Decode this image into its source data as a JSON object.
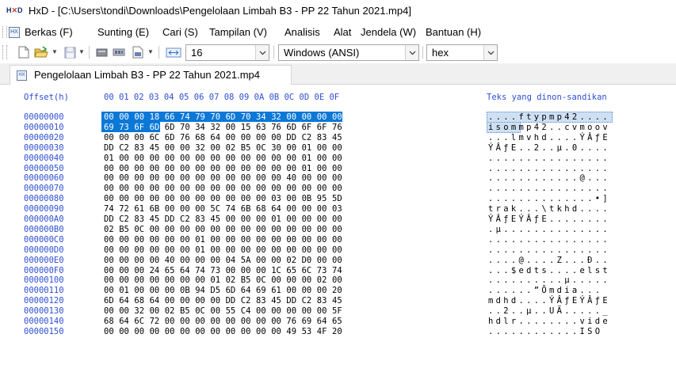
{
  "window": {
    "title": "HxD - [C:\\Users\\tondi\\Downloads\\Pengelolaan Limbah B3 - PP 22 Tahun 2021.mp4]",
    "app_icon_label": "HxD"
  },
  "menu": [
    "Berkas (F)",
    "Sunting (E)",
    "Cari (S)",
    "Tampilan (V)",
    "Analisis",
    "Alat",
    "Jendela (W)",
    "Bantuan (H)"
  ],
  "toolbar": {
    "icons": [
      "new-file-icon",
      "open-file-icon",
      "save-icon",
      "disk-icon",
      "ram-icon",
      "open-disk-image-icon",
      "bytes-per-row-icon"
    ],
    "bytes_per_row": "16",
    "charset": "Windows (ANSI)",
    "offset_base": "hex"
  },
  "tab": {
    "label": "Pengelolaan Limbah B3 - PP 22 Tahun 2021.mp4"
  },
  "editor": {
    "offset_header": "Offset(h)",
    "column_headers": [
      "00",
      "01",
      "02",
      "03",
      "04",
      "05",
      "06",
      "07",
      "08",
      "09",
      "0A",
      "0B",
      "0C",
      "0D",
      "0E",
      "0F"
    ],
    "text_header": "Teks yang dinon-sandikan",
    "selection": {
      "start_offset": "00000000",
      "length_bytes": 20
    },
    "rows": [
      {
        "offset": "00000000",
        "hex": "00 00 00 18 66 74 79 70 6D 70 34 32 00 00 00 00",
        "text": "....ftypmp42...."
      },
      {
        "offset": "00000010",
        "hex": "69 73 6F 6D 6D 70 34 32 00 15 63 76 6D 6F 6F 76",
        "text": "isommp42..cvmoov"
      },
      {
        "offset": "00000020",
        "hex": "00 00 00 6C 6D 76 68 64 00 00 00 00 DD C2 83 45",
        "text": "...lmvhd....ÝÂƒE"
      },
      {
        "offset": "00000030",
        "hex": "DD C2 83 45 00 00 32 00 02 B5 0C 30 00 01 00 00",
        "text": "ÝÂƒE..2..µ.0...."
      },
      {
        "offset": "00000040",
        "hex": "01 00 00 00 00 00 00 00 00 00 00 00 00 01 00 00",
        "text": "................"
      },
      {
        "offset": "00000050",
        "hex": "00 00 00 00 00 00 00 00 00 00 00 00 00 01 00 00",
        "text": "................"
      },
      {
        "offset": "00000060",
        "hex": "00 00 00 00 00 00 00 00 00 00 00 00 40 00 00 00",
        "text": "............@..."
      },
      {
        "offset": "00000070",
        "hex": "00 00 00 00 00 00 00 00 00 00 00 00 00 00 00 00",
        "text": "................"
      },
      {
        "offset": "00000080",
        "hex": "00 00 00 00 00 00 00 00 00 00 00 03 00 0B 95 5D",
        "text": "..............•]"
      },
      {
        "offset": "00000090",
        "hex": "74 72 61 6B 00 00 00 5C 74 6B 68 64 00 00 00 03",
        "text": "trak...\\tkhd...."
      },
      {
        "offset": "000000A0",
        "hex": "DD C2 83 45 DD C2 83 45 00 00 00 01 00 00 00 00",
        "text": "ÝÂƒEÝÂƒE........"
      },
      {
        "offset": "000000B0",
        "hex": "02 B5 0C 00 00 00 00 00 00 00 00 00 00 00 00 00",
        "text": ".µ.............."
      },
      {
        "offset": "000000C0",
        "hex": "00 00 00 00 00 00 01 00 00 00 00 00 00 00 00 00",
        "text": "................"
      },
      {
        "offset": "000000D0",
        "hex": "00 00 00 00 00 00 01 00 00 00 00 00 00 00 00 00",
        "text": "................"
      },
      {
        "offset": "000000E0",
        "hex": "00 00 00 00 40 00 00 00 04 5A 00 00 02 D0 00 00",
        "text": "....@....Z...Ð.."
      },
      {
        "offset": "000000F0",
        "hex": "00 00 00 24 65 64 74 73 00 00 00 1C 65 6C 73 74",
        "text": "...$edts....elst"
      },
      {
        "offset": "00000100",
        "hex": "00 00 00 00 00 00 00 01 02 B5 0C 00 00 00 02 00",
        "text": "..........µ....."
      },
      {
        "offset": "00000110",
        "hex": "00 01 00 00 00 0B 94 D5 6D 64 69 61 00 00 00 20",
        "text": "......”Õmdia... "
      },
      {
        "offset": "00000120",
        "hex": "6D 64 68 64 00 00 00 00 DD C2 83 45 DD C2 83 45",
        "text": "mdhd....ÝÂƒEÝÂƒE"
      },
      {
        "offset": "00000130",
        "hex": "00 00 32 00 02 B5 0C 00 55 C4 00 00 00 00 00 5F",
        "text": "..2..µ..UÄ....._"
      },
      {
        "offset": "00000140",
        "hex": "68 64 6C 72 00 00 00 00 00 00 00 00 76 69 64 65",
        "text": "hdlr........vide"
      },
      {
        "offset": "00000150",
        "hex": "00 00 00 00 00 00 00 00 00 00 00 00 49 53 4F 20",
        "text": "............ISO "
      }
    ]
  }
}
